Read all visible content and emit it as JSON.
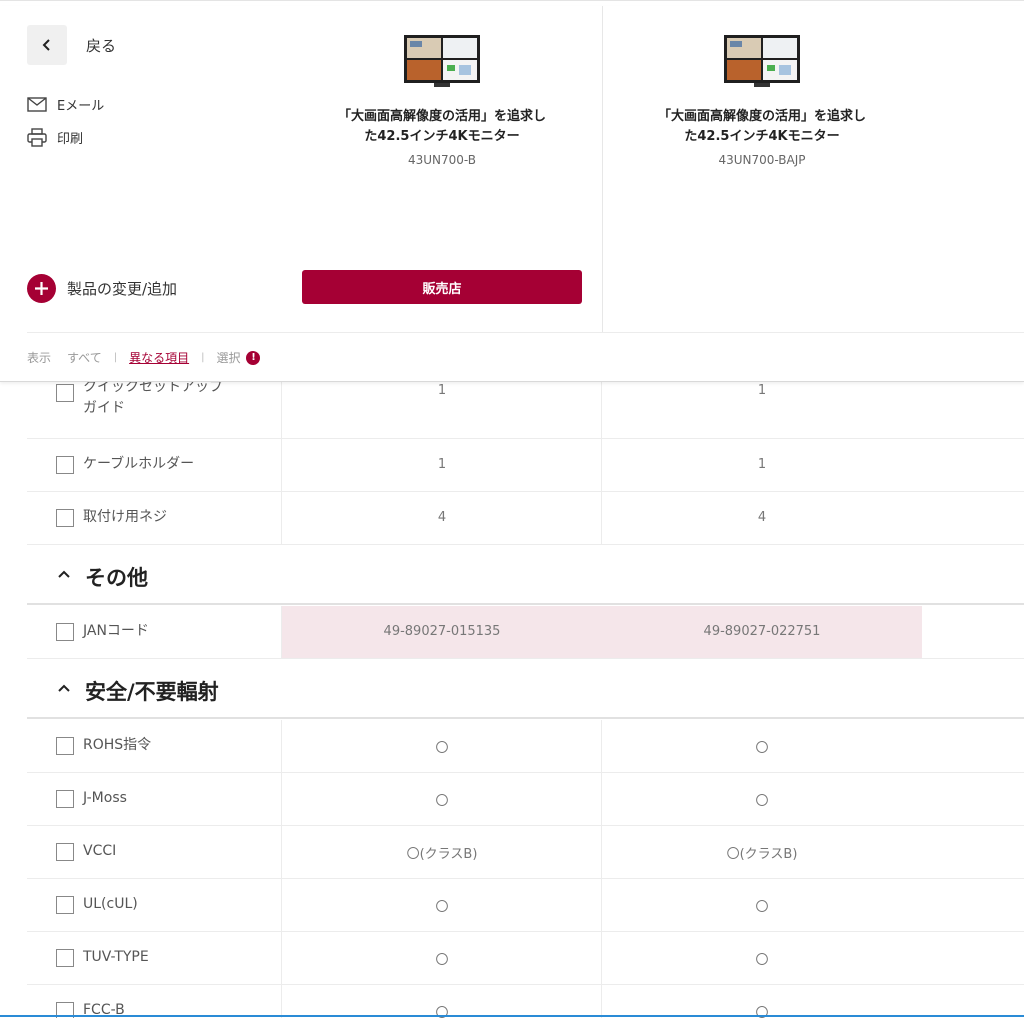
{
  "header": {
    "back_label": "戻る",
    "email_label": "Eメール",
    "print_label": "印刷",
    "add_product_label": "製品の変更/追加",
    "dealer_button": "販売店"
  },
  "products": [
    {
      "title_line1": "「大画面高解像度の活用」を追求し",
      "title_line2": "た42.5インチ4Kモニター",
      "model": "43UN700-B"
    },
    {
      "title_line1": "「大画面高解像度の活用」を追求し",
      "title_line2": "た42.5インチ4Kモニター",
      "model": "43UN700-BAJP"
    }
  ],
  "filter": {
    "display_label": "表示",
    "all_label": "すべて",
    "diff_label": "異なる項目",
    "select_label": "選択",
    "info_icon_text": "!"
  },
  "rows_top": [
    {
      "label_line1": "クイックセットアップ",
      "label_line2": "ガイド",
      "v1": "1",
      "v2": "1"
    },
    {
      "label": "ケーブルホルダー",
      "v1": "1",
      "v2": "1"
    },
    {
      "label": "取付け用ネジ",
      "v1": "4",
      "v2": "4"
    }
  ],
  "section_other": {
    "title": "その他"
  },
  "jan_row": {
    "label": "JANコード",
    "v1": "49-89027-015135",
    "v2": "49-89027-022751"
  },
  "section_safety": {
    "title": "安全/不要輻射"
  },
  "safety_rows": [
    {
      "label": "ROHS指令",
      "v1": "〇",
      "v2": "〇"
    },
    {
      "label": "J-Moss",
      "v1": "〇",
      "v2": "〇"
    },
    {
      "label": "VCCI",
      "v1": "〇(クラスB)",
      "v2": "〇(クラスB)"
    },
    {
      "label": "UL(cUL)",
      "v1": "〇",
      "v2": "〇"
    },
    {
      "label": "TUV-TYPE",
      "v1": "〇",
      "v2": "〇"
    },
    {
      "label": "FCC-B",
      "v1": "〇",
      "v2": "〇"
    }
  ],
  "colors": {
    "accent": "#a50034",
    "diff_bg": "#f5e6ea"
  }
}
